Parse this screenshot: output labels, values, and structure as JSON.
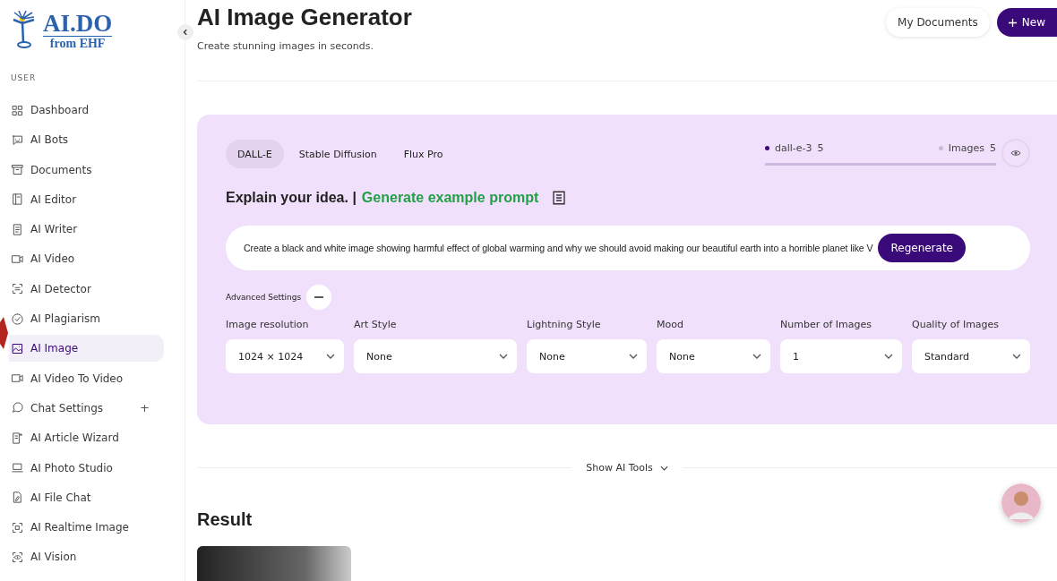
{
  "logo": {
    "title": "AI.DO",
    "subtitle": "from EHF"
  },
  "sidebar": {
    "section": "USER",
    "items": [
      {
        "label": "Dashboard",
        "selected": false
      },
      {
        "label": "AI Bots",
        "selected": false
      },
      {
        "label": "Documents",
        "selected": false
      },
      {
        "label": "AI Editor",
        "selected": false
      },
      {
        "label": "AI Writer",
        "selected": false
      },
      {
        "label": "AI Video",
        "selected": false
      },
      {
        "label": "AI Detector",
        "selected": false
      },
      {
        "label": "AI Plagiarism",
        "selected": false
      },
      {
        "label": "AI Image",
        "selected": true
      },
      {
        "label": "AI Video To Video",
        "selected": false
      },
      {
        "label": "Chat Settings",
        "selected": false,
        "expand": "+"
      },
      {
        "label": "AI Article Wizard",
        "selected": false
      },
      {
        "label": "AI Photo Studio",
        "selected": false
      },
      {
        "label": "AI File Chat",
        "selected": false
      },
      {
        "label": "AI Realtime Image",
        "selected": false
      },
      {
        "label": "AI Vision",
        "selected": false
      }
    ]
  },
  "header": {
    "title": "AI Image Generator",
    "subtitle": "Create stunning images in seconds.",
    "buttons": [
      {
        "label": "My Documents",
        "kind": "secondary"
      },
      {
        "label": "New",
        "kind": "primary"
      }
    ]
  },
  "generator": {
    "tabs": [
      {
        "label": "DALL-E",
        "selected": true
      },
      {
        "label": "Stable Diffusion",
        "selected": false
      },
      {
        "label": "Flux Pro",
        "selected": false
      }
    ],
    "stats": [
      {
        "label": "dall-e-3",
        "value": "5",
        "color": "#3b0a7a"
      },
      {
        "label": "Images",
        "value": "5",
        "color": "#c9b8dc"
      }
    ],
    "prompt_heading": "Explain your idea. |",
    "example_link": "Generate example prompt",
    "prompt": "Create a black and white image showing harmful effect of global warming and why we should avoid making our beautiful earth into a horrible planet like V",
    "regenerate": "Regenerate",
    "advanced": "Advanced Settings",
    "settings": [
      {
        "label": "Image resolution",
        "value": "1024 × 1024"
      },
      {
        "label": "Art Style",
        "value": "None"
      },
      {
        "label": "Lightning Style",
        "value": "None"
      },
      {
        "label": "Mood",
        "value": "None"
      },
      {
        "label": "Number of Images",
        "value": "1"
      },
      {
        "label": "Quality of Images",
        "value": "Standard"
      }
    ]
  },
  "show_tools": "Show AI Tools",
  "result": {
    "title": "Result"
  }
}
